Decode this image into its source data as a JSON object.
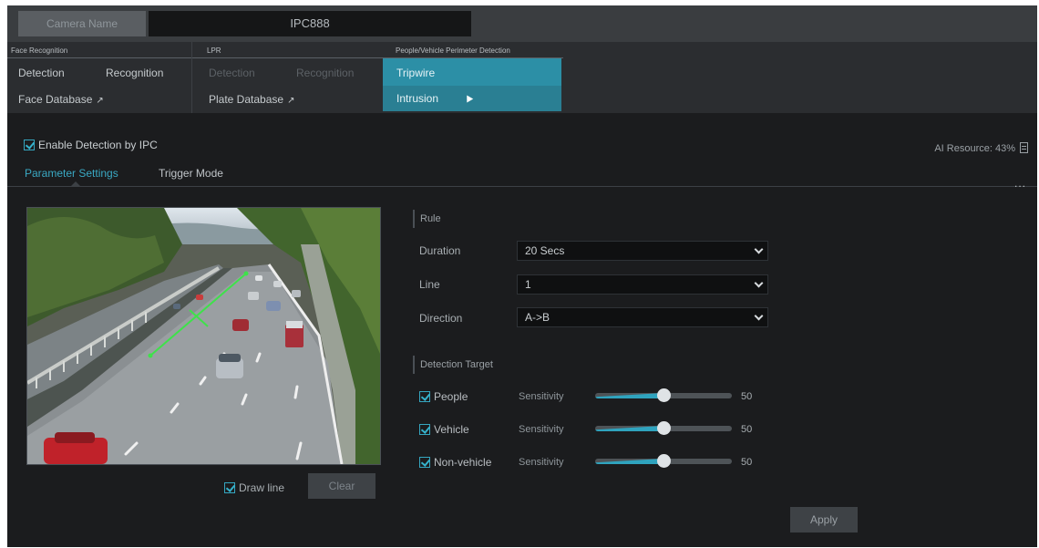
{
  "header": {
    "camera_name_label": "Camera Name",
    "camera_name_value": "IPC888"
  },
  "menu": {
    "face": {
      "title": "Face Recognition",
      "detection": "Detection",
      "recognition": "Recognition",
      "database": "Face Database"
    },
    "lpr": {
      "title": "LPR",
      "detection": "Detection",
      "recognition": "Recognition",
      "database": "Plate Database"
    },
    "pvd": {
      "title": "People/Vehicle Perimeter Detection",
      "items": [
        "Tripwire",
        "Intrusion"
      ],
      "selected": "Intrusion"
    }
  },
  "enable": {
    "label": "Enable Detection by IPC",
    "checked": true
  },
  "ai_resource": "AI Resource: 43%",
  "tabs": [
    {
      "label": "Parameter Settings",
      "active": true
    },
    {
      "label": "Trigger Mode",
      "active": false
    }
  ],
  "more": "...",
  "video": {
    "draw_line_label": "Draw line",
    "draw_line_checked": true,
    "clear_label": "Clear"
  },
  "rule": {
    "title": "Rule",
    "duration_label": "Duration",
    "duration_value": "20 Secs",
    "line_label": "Line",
    "line_value": "1",
    "direction_label": "Direction",
    "direction_value": "A->B"
  },
  "detection_target": {
    "title": "Detection Target",
    "sensitivity_label": "Sensitivity",
    "items": [
      {
        "label": "People",
        "checked": true,
        "sensitivity": 50
      },
      {
        "label": "Vehicle",
        "checked": true,
        "sensitivity": 50
      },
      {
        "label": "Non-vehicle",
        "checked": true,
        "sensitivity": 50
      }
    ]
  },
  "apply_label": "Apply",
  "colors": {
    "accent": "#2fa3be",
    "dropdown": "#2c8fa6",
    "background": "#1b1c1e"
  }
}
